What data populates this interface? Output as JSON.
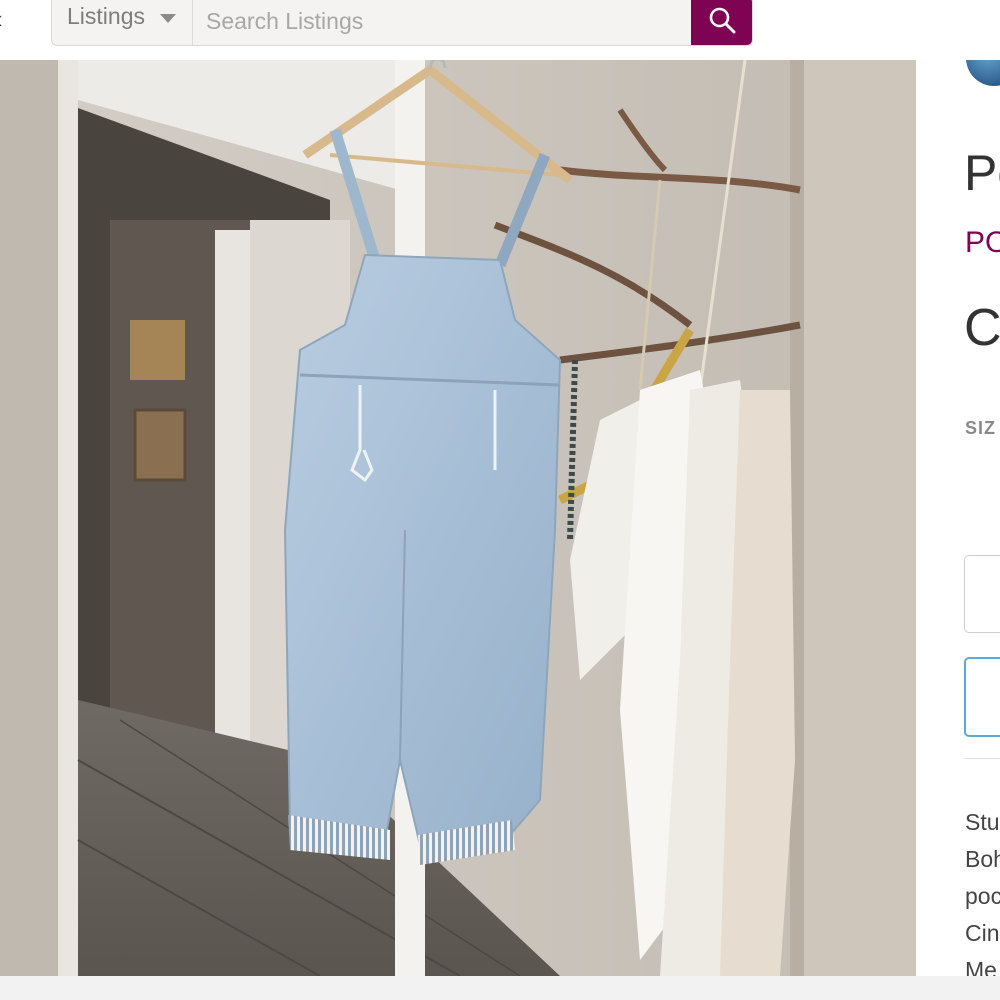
{
  "search": {
    "scope_label": "Listings",
    "placeholder": "Search Listings",
    "value": ""
  },
  "listing": {
    "title_partial": "Po",
    "brand_partial": "PO",
    "price_partial": "C",
    "size_label_partial": "SIZ",
    "description_lines": [
      "Stu",
      "Boh",
      "poc",
      "Cin",
      "Me"
    ]
  },
  "colors": {
    "accent": "#7f0353",
    "selected_border": "#5aa9d8"
  },
  "icons": {
    "search": "search-icon",
    "caret": "chevron-down-icon",
    "back": "back-icon"
  }
}
